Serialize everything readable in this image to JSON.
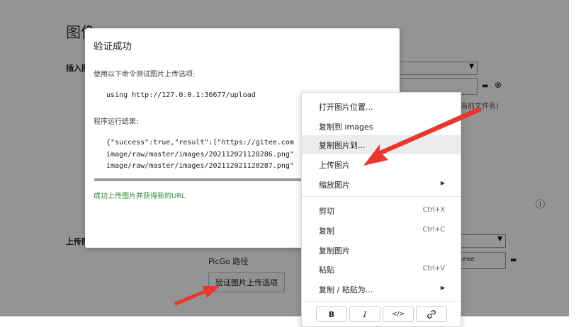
{
  "background": {
    "page_title": "图像",
    "insert_label": "插入图",
    "upload_label": "上传服",
    "relative_hint": "于当前文件名)",
    "picgo_path_label": "PicGo 路径",
    "picgo_path_value": "exe",
    "verify_button": "验证图片上传选项"
  },
  "dialog": {
    "title": "验证成功",
    "prompt": "使用以下命令测试图片上传选项:",
    "command": "using http://127.0.0.1:36677/upload",
    "result_label": "程序运行结果:",
    "result_lines": [
      "{\"success\":true,\"result\":[\"https://gitee.com",
      "image/raw/master/images/202112021128286.png\"",
      "image/raw/master/images/202112021128287.png\""
    ],
    "success_text": "成功上传图片并获得新的URL"
  },
  "context_menu": {
    "items": [
      {
        "label": "打开图片位置..."
      },
      {
        "label": "复制到 images"
      },
      {
        "label": "复制图片到..."
      },
      {
        "label": "上传图片"
      },
      {
        "label": "缩放图片",
        "submenu": true
      },
      {
        "label": "剪切",
        "shortcut": "Ctrl+X"
      },
      {
        "label": "复制",
        "shortcut": "Ctrl+C"
      },
      {
        "label": "复制图片"
      },
      {
        "label": "粘贴",
        "shortcut": "Ctrl+V"
      },
      {
        "label": "复制 / 粘贴为...",
        "submenu": true
      }
    ],
    "format_buttons": [
      "B",
      "I",
      "</>",
      "link-icon"
    ]
  },
  "colors": {
    "overlay": "rgba(0,0,0,0.42)",
    "success_green": "#2e8b3a",
    "arrow_red": "#e8372c",
    "highlight": "#ececec"
  }
}
